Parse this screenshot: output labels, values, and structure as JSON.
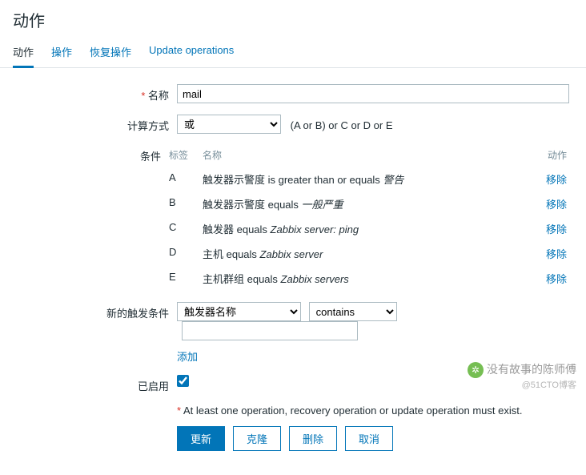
{
  "page_title": "动作",
  "tabs": [
    "动作",
    "操作",
    "恢复操作",
    "Update operations"
  ],
  "active_tab_index": 0,
  "form": {
    "name_label": "名称",
    "name_value": "mail",
    "calc_label": "计算方式",
    "calc_value": "或",
    "calc_expr": "(A or B) or C or D or E",
    "cond_label": "条件",
    "cond_headers": {
      "tag": "标签",
      "name": "名称",
      "action": "动作"
    },
    "conditions": [
      {
        "tag": "A",
        "prefix": "触发器示警度 is greater than or equals ",
        "val": "警告"
      },
      {
        "tag": "B",
        "prefix": "触发器示警度 equals ",
        "val": "一般严重"
      },
      {
        "tag": "C",
        "prefix": "触发器 equals ",
        "val": "Zabbix server: ping"
      },
      {
        "tag": "D",
        "prefix": "主机 equals ",
        "val": "Zabbix server"
      },
      {
        "tag": "E",
        "prefix": "主机群组 equals ",
        "val": "Zabbix servers"
      }
    ],
    "remove_label": "移除",
    "newcond_label": "新的触发条件",
    "newcond_type": "触发器名称",
    "newcond_op": "contains",
    "newcond_val": "",
    "add_label": "添加",
    "enabled_label": "已启用",
    "enabled_checked": true,
    "warning": "At least one operation, recovery operation or update operation must exist.",
    "buttons": {
      "update": "更新",
      "clone": "克隆",
      "delete": "删除",
      "cancel": "取消"
    }
  },
  "watermark": {
    "line1": "没有故事的陈师傅",
    "line2": "@51CTO博客"
  }
}
